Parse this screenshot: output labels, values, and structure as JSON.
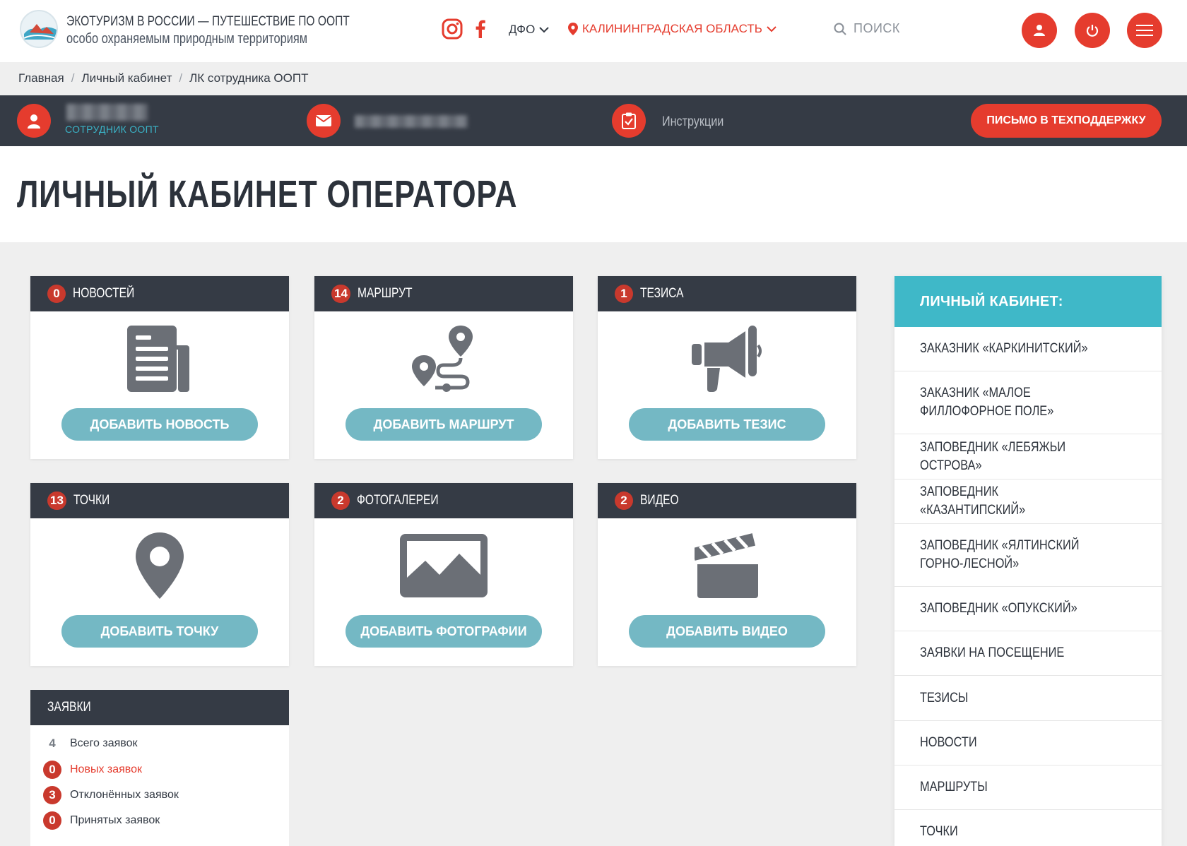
{
  "header": {
    "title_line1": "ЭКОТУРИЗМ В РОССИИ — ПУТЕШЕСТВИЕ ПО ООПТ",
    "title_line2": "особо охраняемым природным территориям",
    "dfo": "ДФО",
    "region": "КАЛИНИНГРАДСКАЯ ОБЛАСТЬ",
    "search_placeholder": "ПОИСК"
  },
  "breadcrumb": [
    "Главная",
    "Личный кабинет",
    "ЛК сотрудника ООПТ"
  ],
  "profile": {
    "role": "СОТРУДНИК ООПТ",
    "instructions": "Инструкции",
    "support_button": "ПИСЬМО В ТЕХПОДДЕРЖКУ"
  },
  "page_title": "ЛИЧНЫЙ КАБИНЕТ ОПЕРАТОРА",
  "cards": [
    {
      "count": "0",
      "label": "НОВОСТЕЙ",
      "button": "ДОБАВИТЬ НОВОСТЬ",
      "icon": "newspaper-icon"
    },
    {
      "count": "14",
      "label": "МАРШРУТ",
      "button": "ДОБАВИТЬ МАРШРУТ",
      "icon": "route-icon"
    },
    {
      "count": "1",
      "label": "ТЕЗИСА",
      "button": "ДОБАВИТЬ ТЕЗИС",
      "icon": "megaphone-icon"
    },
    {
      "count": "13",
      "label": "ТОЧКИ",
      "button": "ДОБАВИТЬ ТОЧКУ",
      "icon": "map-pin-icon"
    },
    {
      "count": "2",
      "label": "ФОТОГАЛЕРЕИ",
      "button": "ДОБАВИТЬ ФОТОГРАФИИ",
      "icon": "image-icon"
    },
    {
      "count": "2",
      "label": "ВИДЕО",
      "button": "ДОБАВИТЬ ВИДЕО",
      "icon": "clapperboard-icon"
    }
  ],
  "requests": {
    "title": "ЗАЯВКИ",
    "rows": [
      {
        "count": "4",
        "label": "Всего заявок"
      },
      {
        "count": "0",
        "label": "Новых заявок"
      },
      {
        "count": "3",
        "label": "Отклонённых заявок"
      },
      {
        "count": "0",
        "label": "Принятых заявок"
      }
    ]
  },
  "sidebar": {
    "title": "ЛИЧНЫЙ КАБИНЕТ:",
    "items": [
      "ЗАКАЗНИК «КАРКИНИТСКИЙ»",
      "ЗАКАЗНИК «МАЛОЕ ФИЛЛОФОРНОЕ ПОЛЕ»",
      "ЗАПОВЕДНИК «ЛЕБЯЖЬИ ОСТРОВА»",
      "ЗАПОВЕДНИК «КАЗАНТИПСКИЙ»",
      "ЗАПОВЕДНИК «ЯЛТИНСКИЙ ГОРНО-ЛЕСНОЙ»",
      "ЗАПОВЕДНИК «ОПУКСКИЙ»",
      "ЗАЯВКИ НА ПОСЕЩЕНИЕ",
      "ТЕЗИСЫ",
      "НОВОСТИ",
      "МАРШРУТЫ",
      "ТОЧКИ"
    ]
  },
  "colors": {
    "accent": "#e53c2e",
    "dark": "#353b45",
    "teal": "#3fb8c8",
    "button": "#74b8c4"
  }
}
